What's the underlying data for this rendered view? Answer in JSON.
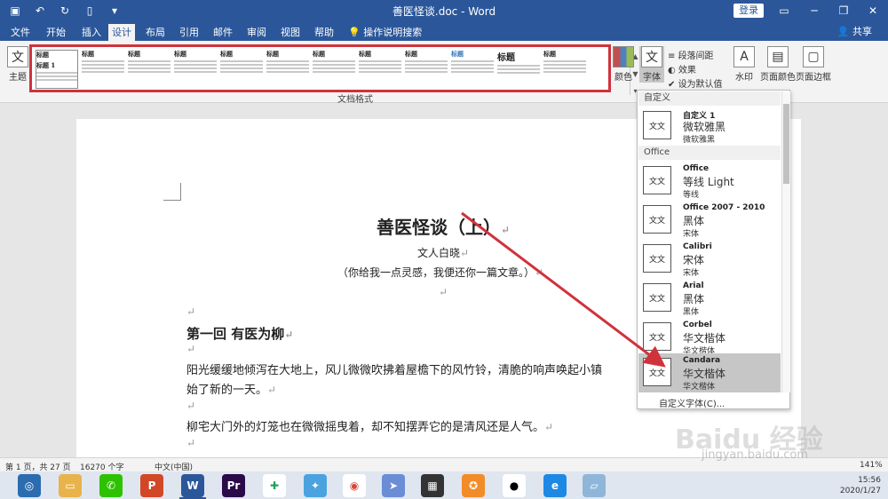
{
  "window": {
    "title": "善医怪谈.doc - Word",
    "login": "登录"
  },
  "tabs": [
    {
      "label": "文件"
    },
    {
      "label": "开始"
    },
    {
      "label": "插入"
    },
    {
      "label": "设计"
    },
    {
      "label": "布局"
    },
    {
      "label": "引用"
    },
    {
      "label": "邮件"
    },
    {
      "label": "审阅"
    },
    {
      "label": "视图"
    },
    {
      "label": "帮助"
    },
    {
      "label": "操作说明搜索"
    }
  ],
  "share": "共享",
  "ribbon": {
    "theme_label": "主题",
    "style_set_group": "文档格式",
    "style_heading": "标题",
    "style_heading1": "标题 1",
    "colors_label": "颜色",
    "fonts_label": "字体",
    "paragraph_spacing": "段落间距",
    "effects": "效果",
    "set_default": "设为默认值",
    "watermark": "水印",
    "page_color": "页面颜色",
    "page_border": "页面边框"
  },
  "document": {
    "title": "善医怪谈（上）",
    "author": "文人白晓",
    "subtitle": "（你给我一点灵感，我便还你一篇文章。）",
    "chapter": "第一回  有医为柳",
    "para1_line1": "阳光缓缓地倾泻在大地上，风儿微微吹拂着屋檐下的风竹铃，清脆的响声唤起小镇",
    "para1_line2": "始了新的一天。",
    "para2": "柳宅大门外的灯笼也在微微摇曳着，却不知摆弄它的是清风还是人气。",
    "para_mark": "↵"
  },
  "font_dropdown": {
    "section_custom": "自定义",
    "section_office": "Office",
    "items": [
      {
        "name": "自定义 1",
        "heading": "微软雅黑",
        "body": "微软雅黑",
        "icon": "文文"
      },
      {
        "name": "Office",
        "heading": "等线 Light",
        "body": "等线",
        "icon": "文文"
      },
      {
        "name": "Office 2007 - 2010",
        "heading": "黑体",
        "body": "宋体",
        "icon": "文文"
      },
      {
        "name": "Calibri",
        "heading": "宋体",
        "body": "宋体",
        "icon": "文文"
      },
      {
        "name": "Arial",
        "heading": "黑体",
        "body": "黑体",
        "icon": "文文"
      },
      {
        "name": "Corbel",
        "heading": "华文楷体",
        "body": "华文楷体",
        "icon": "文文"
      },
      {
        "name": "Candara",
        "heading": "华文楷体",
        "body": "华文楷体",
        "icon": "文文"
      }
    ],
    "custom_link": "自定义字体(C)..."
  },
  "status": {
    "page": "第 1 页，共 27 页",
    "words": "16270 个字",
    "language": "中文(中国)",
    "zoom": "141%"
  },
  "taskbar": {
    "time": "15:56",
    "date": "2020/1/27"
  },
  "watermark": "Baidu 经验",
  "watermark_url": "jingyan.baidu.com",
  "colors": {
    "ribbon_blue": "#2b579a",
    "highlight_red": "#d0323c",
    "hover_gray": "#c6c6c6"
  }
}
